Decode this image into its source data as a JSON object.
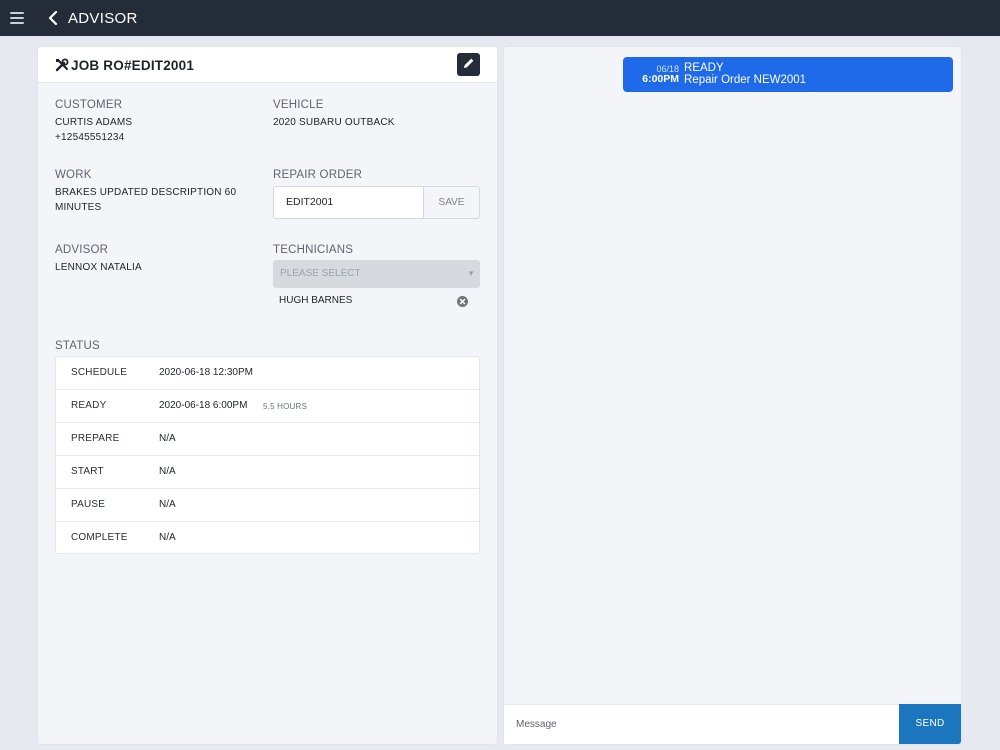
{
  "topbar": {
    "title": "ADVISOR",
    "menu_icon": "hamburger-menu-icon",
    "back_icon": "chevron-left-icon"
  },
  "job": {
    "title": "JOB RO#EDIT2001",
    "title_icon": "tools-icon",
    "edit_icon": "pencil-icon"
  },
  "customer": {
    "label": "CUSTOMER",
    "name": "CURTIS ADAMS",
    "phone": "+12545551234"
  },
  "vehicle": {
    "label": "VEHICLE",
    "value": "2020 SUBARU OUTBACK"
  },
  "work": {
    "label": "WORK",
    "line1": "BRAKES UPDATED DESCRIPTION 60",
    "line2": "MINUTES"
  },
  "repair_order": {
    "label": "REPAIR ORDER",
    "value": "EDIT2001",
    "save_label": "SAVE"
  },
  "advisor": {
    "label": "ADVISOR",
    "value": "LENNOX NATALIA"
  },
  "technicians": {
    "label": "TECHNICIANS",
    "placeholder": "PLEASE SELECT",
    "selected": [
      "HUGH BARNES"
    ],
    "remove_icon": "close-circle-icon"
  },
  "status": {
    "label": "STATUS",
    "rows": [
      {
        "name": "SCHEDULE",
        "value": "2020-06-18 12:30PM",
        "extra": ""
      },
      {
        "name": "READY",
        "value": "2020-06-18 6:00PM",
        "extra": "5.5 HOURS"
      },
      {
        "name": "PREPARE",
        "value": "N/A",
        "extra": ""
      },
      {
        "name": "START",
        "value": "N/A",
        "extra": ""
      },
      {
        "name": "PAUSE",
        "value": "N/A",
        "extra": ""
      },
      {
        "name": "COMPLETE",
        "value": "N/A",
        "extra": ""
      }
    ]
  },
  "messages": [
    {
      "date": "06/18",
      "time": "6:00PM",
      "status": "READY",
      "text": "Repair Order NEW2001"
    }
  ],
  "composer": {
    "placeholder": "Message",
    "send_label": "SEND"
  },
  "colors": {
    "topbar": "#252c39",
    "accent": "#1e6ae8",
    "send": "#1c76bd"
  }
}
